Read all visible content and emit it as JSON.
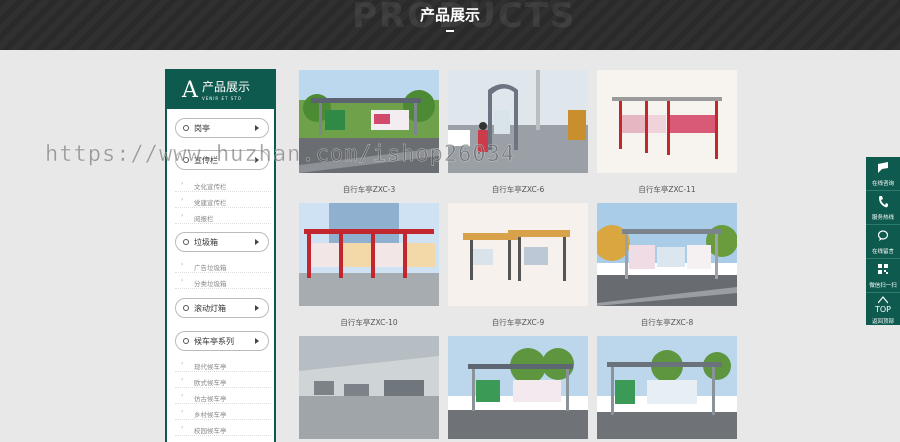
{
  "banner": {
    "title": "产品展示",
    "ghost_text": "PRODUCTS"
  },
  "sidebar": {
    "letter": "A",
    "title": "产品展示",
    "subtitle": "VENIR ET STO",
    "categories": [
      {
        "label": "岗亭"
      },
      {
        "label": "宣传栏"
      },
      {
        "label": "垃圾箱"
      },
      {
        "label": "滚动灯箱"
      },
      {
        "label": "候车亭系列"
      }
    ],
    "subitems": {
      "xuanchuan": [
        "文化宣传栏",
        "党建宣传栏",
        "阅报栏"
      ],
      "laji": [
        "广告垃圾箱",
        "分类垃圾箱"
      ],
      "houche": [
        "现代候车亭",
        "欧式候车亭",
        "仿古候车亭",
        "乡村候车亭",
        "校园候车亭"
      ]
    }
  },
  "products": [
    {
      "name": "自行车亭ZXC-3"
    },
    {
      "name": "自行车亭ZXC-6"
    },
    {
      "name": "自行车亭ZXC-11"
    },
    {
      "name": "自行车亭ZXC-10"
    },
    {
      "name": "自行车亭ZXC-9"
    },
    {
      "name": "自行车亭ZXC-8"
    },
    {
      "name": ""
    },
    {
      "name": ""
    },
    {
      "name": ""
    }
  ],
  "floatbar": [
    {
      "label": "在线咨询",
      "icon": "chat-icon"
    },
    {
      "label": "服务热线",
      "icon": "phone-icon"
    },
    {
      "label": "在线留言",
      "icon": "message-icon"
    },
    {
      "label": "微信扫一扫",
      "icon": "qrcode-icon"
    },
    {
      "label": "返回顶部",
      "top": "TOP",
      "icon": "arrow-up-icon"
    }
  ],
  "watermark": "https://www.huzhan.com/ishop26034",
  "colors": {
    "accent": "#0f5a4f",
    "banner": "#2a2a2a",
    "background": "#e8e8e8"
  }
}
